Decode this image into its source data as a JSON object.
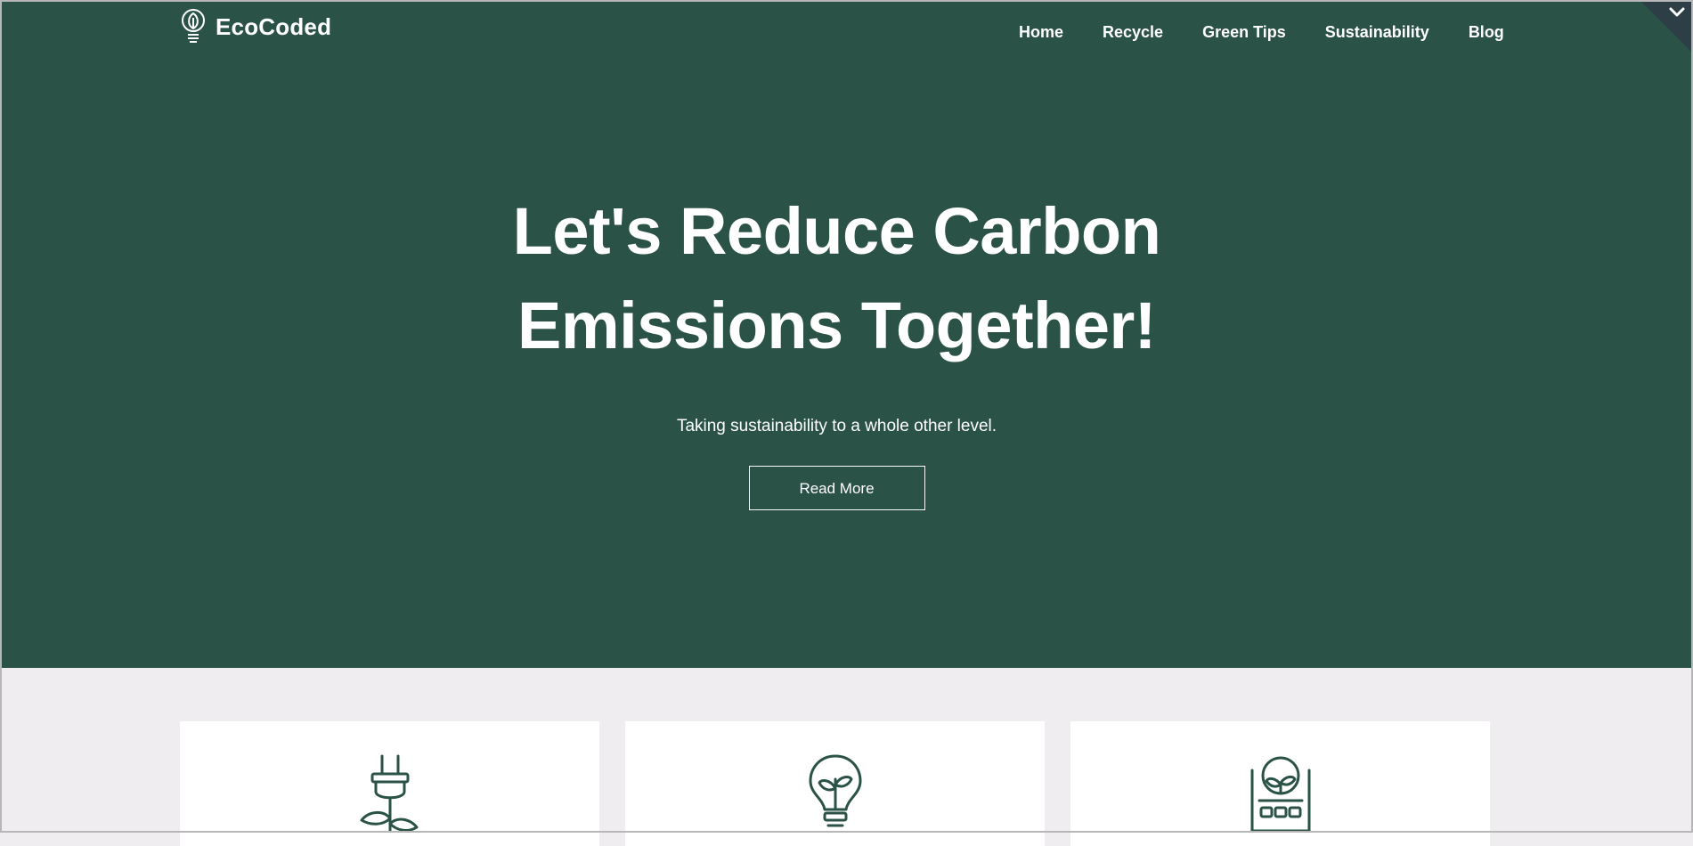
{
  "brand": {
    "name": "EcoCoded",
    "icon": "lightbulb-leaf-icon"
  },
  "nav": {
    "items": [
      {
        "label": "Home"
      },
      {
        "label": "Recycle"
      },
      {
        "label": "Green Tips"
      },
      {
        "label": "Sustainability"
      },
      {
        "label": "Blog"
      }
    ]
  },
  "hero": {
    "title_line1": "Let's Reduce Carbon",
    "title_line2": "Emissions Together!",
    "subtitle": "Taking sustainability to a whole other level.",
    "cta_label": "Read More"
  },
  "cards": [
    {
      "icon": "plug-plant-icon"
    },
    {
      "icon": "lightbulb-sprout-icon"
    },
    {
      "icon": "solar-panel-plant-icon"
    }
  ],
  "colors": {
    "hero_bg": "#2b5247",
    "page_bg": "#efedef",
    "card_bg": "#ffffff",
    "icon_stroke": "#2b5247",
    "text_light": "#ffffff"
  }
}
